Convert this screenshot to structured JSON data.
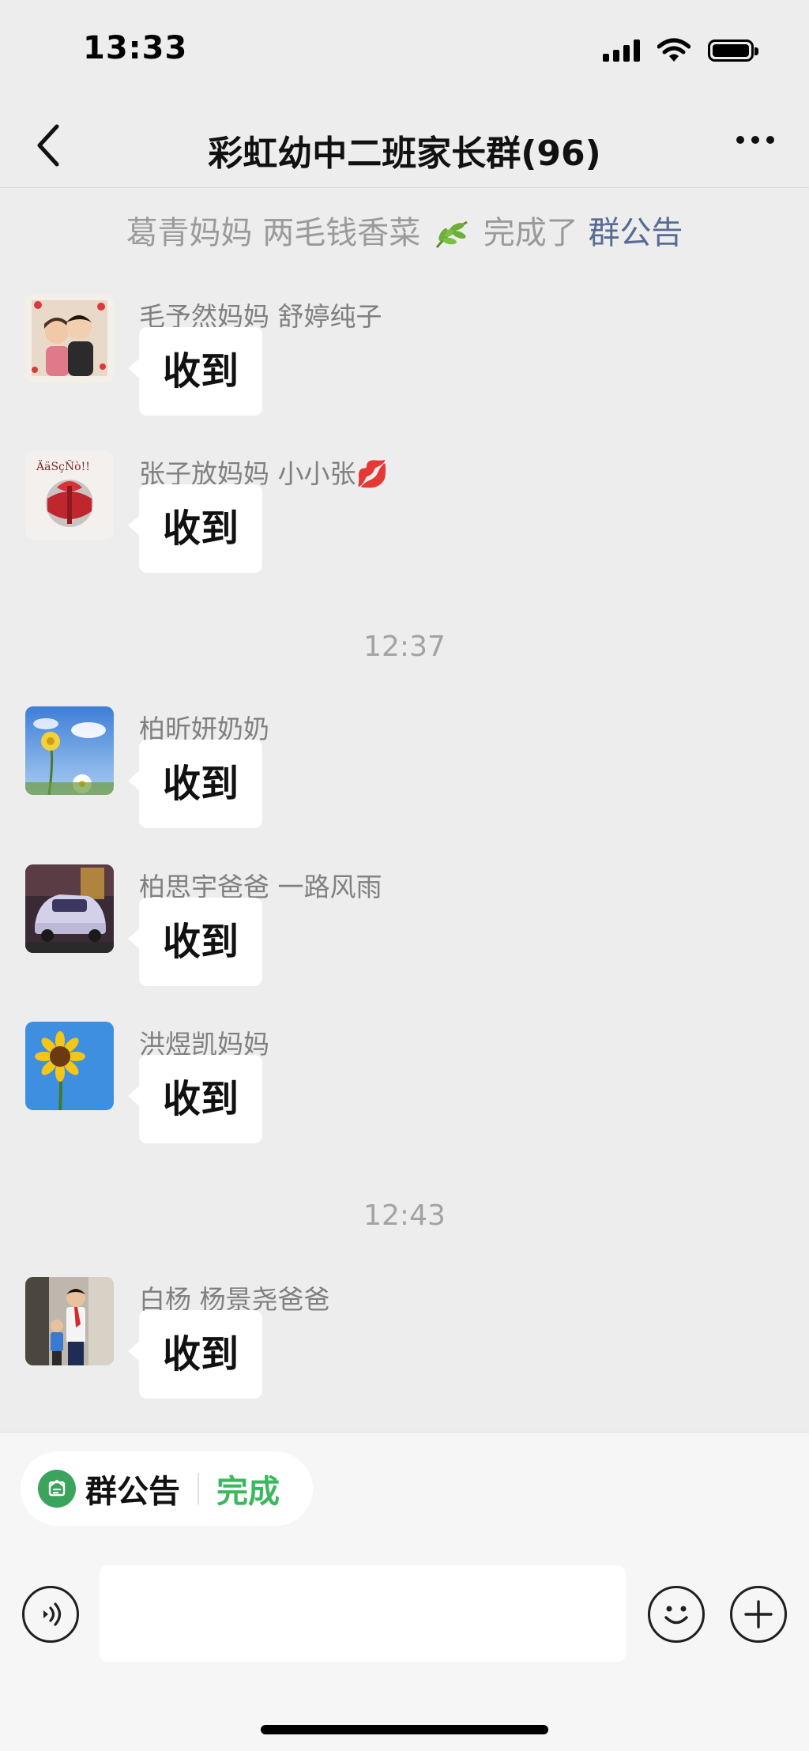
{
  "status_bar": {
    "time": "13:33"
  },
  "nav": {
    "title": "彩虹幼中二班家长群(96)"
  },
  "notice": {
    "text": "葛青妈妈  两毛钱香菜",
    "status": "完成了",
    "link": "群公告"
  },
  "messages": [
    {
      "sender": "毛予然妈妈  舒婷纯子",
      "text": "收到",
      "avatar": "children-photo"
    },
    {
      "sender": "张子放妈妈  小小张",
      "text": "收到",
      "avatar": "gift-photo",
      "sender_emoji": "💋"
    },
    {
      "sender": "柏昕妍奶奶",
      "text": "收到",
      "avatar": "flower-sky-photo"
    },
    {
      "sender": "柏思宇爸爸 一路风雨",
      "text": "收到",
      "avatar": "car-photo"
    },
    {
      "sender": "洪煜凯妈妈",
      "text": "收到",
      "avatar": "sunflower-photo"
    },
    {
      "sender": "白杨  杨景尧爸爸",
      "text": "收到",
      "avatar": "boys-photo"
    }
  ],
  "timestamps": [
    "12:37",
    "12:43"
  ],
  "bottom": {
    "announcement_label": "群公告",
    "done_label": "完成",
    "input_value": ""
  },
  "colors": {
    "link": "#576b95",
    "done_green": "#3ab85e",
    "icon_green": "#3aa35c",
    "background": "#ededed"
  }
}
